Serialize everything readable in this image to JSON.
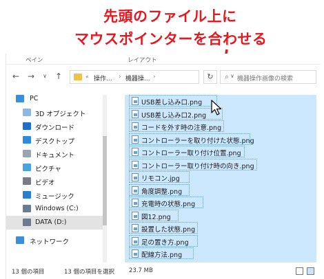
{
  "annotation": {
    "line1": "先頭のファイル上に",
    "line2": "マウスポインターを合わせる",
    "color": "#e8171e"
  },
  "ribbon": {
    "tab_left": "ペイン",
    "tab_right": "レイアウト"
  },
  "address": {
    "prefix": "«",
    "crumb1": "操作...",
    "crumb2": "機器操...",
    "separator": "›"
  },
  "search": {
    "placeholder": "機器操作画像の検索"
  },
  "sidebar": {
    "items": [
      {
        "label": "PC",
        "icon": "pc-icon"
      },
      {
        "label": "3D オブジェクト",
        "icon": "3d-objects-icon"
      },
      {
        "label": "ダウンロード",
        "icon": "download-icon"
      },
      {
        "label": "デスクトップ",
        "icon": "desktop-icon"
      },
      {
        "label": "ドキュメント",
        "icon": "documents-icon"
      },
      {
        "label": "ピクチャ",
        "icon": "pictures-icon"
      },
      {
        "label": "ビデオ",
        "icon": "videos-icon"
      },
      {
        "label": "ミュージック",
        "icon": "music-icon"
      },
      {
        "label": "Windows (C:)",
        "icon": "drive-icon"
      },
      {
        "label": "DATA (D:)",
        "icon": "drive-icon"
      },
      {
        "label": "ネットワーク",
        "icon": "network-icon"
      }
    ]
  },
  "files": [
    "USB差し込み口.png",
    "USB差し込み口2.png",
    "コードを外す時の注意.png",
    "コントローラーを取り付けた状態.png",
    "コントローラー取り付け位置.png",
    "コントローラー取り付け時の向き.png",
    "リモコン.jpg",
    "角度調整.png",
    "充電時の状態.png",
    "図12.png",
    "設置した状態.png",
    "足の置き方.png",
    "配線方法.png"
  ],
  "status": {
    "item_count": "13 個の項目",
    "selected_count": "13 個の項目を選択",
    "size": "23.7 MB"
  },
  "colors": {
    "selection": "#cce8ff",
    "accent": "#1e78d7"
  }
}
